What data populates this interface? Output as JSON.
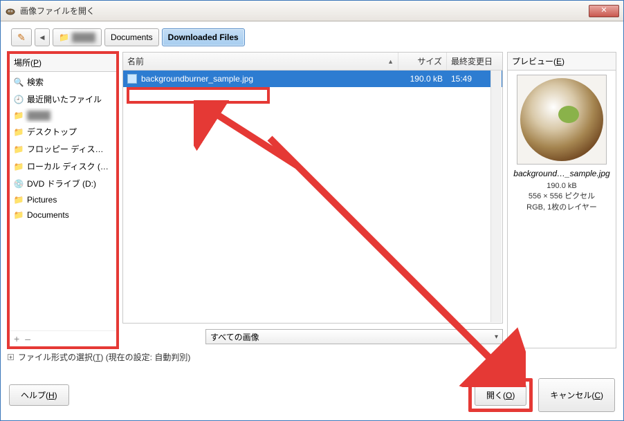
{
  "titlebar": {
    "title": "画像ファイルを開く",
    "close_glyph": "✕"
  },
  "toolbar": {
    "edit_icon": "✎",
    "back_icon": "◀",
    "folder_icon": "📁",
    "documents_label": "Documents",
    "downloaded_label": "Downloaded Files"
  },
  "places": {
    "header": "場所(P)",
    "items": [
      {
        "icon": "🔍",
        "label": "検索"
      },
      {
        "icon": "🕘",
        "label": "最近開いたファイル"
      },
      {
        "icon": "📁",
        "label": "███████"
      },
      {
        "icon": "📁",
        "label": "デスクトップ"
      },
      {
        "icon": "📁",
        "label": "フロッピー ディス…"
      },
      {
        "icon": "📁",
        "label": "ローカル ディスク (…"
      },
      {
        "icon": "💿",
        "label": "DVD ドライブ (D:)"
      },
      {
        "icon": "📁",
        "label": "Pictures"
      },
      {
        "icon": "📁",
        "label": "Documents"
      }
    ],
    "add": "+",
    "remove": "–"
  },
  "filelist": {
    "cols": {
      "name": "名前",
      "size": "サイズ",
      "date": "最終変更日",
      "sort_arrow": "▲"
    },
    "rows": [
      {
        "name": "backgroundburner_sample.jpg",
        "size": "190.0 kB",
        "date": "15:49"
      }
    ]
  },
  "preview": {
    "header": "プレビュー(E)",
    "filename": "background…_sample.jpg",
    "size": "190.0 kB",
    "dims": "556 × 556 ピクセル",
    "mode": "RGB, 1枚のレイヤー"
  },
  "filter": {
    "selected": "すべての画像"
  },
  "expander": {
    "label": "ファイル形式の選択(T)",
    "suffix": "(現在の設定: 自動判別)"
  },
  "buttons": {
    "help": "ヘルプ(H)",
    "open": "開く(O)",
    "cancel": "キャンセル(C)"
  }
}
